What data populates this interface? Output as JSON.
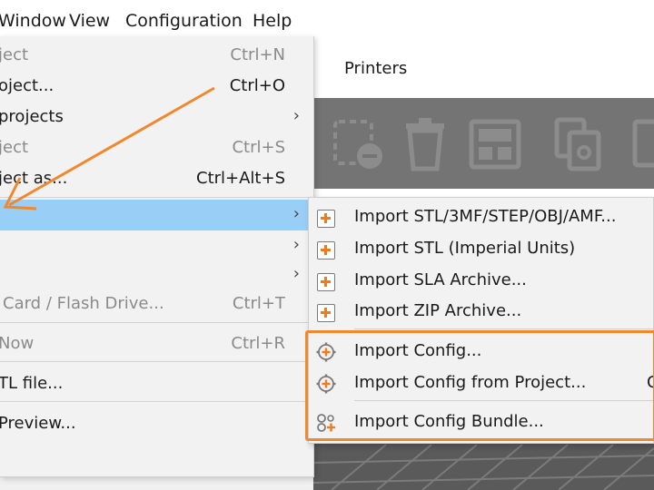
{
  "menubar": {
    "items": [
      "Window",
      "View",
      "Configuration",
      "Help"
    ]
  },
  "app": {
    "printers_tab": "Printers"
  },
  "file_menu": {
    "items": [
      {
        "label": "ject",
        "shortcut": "Ctrl+N",
        "disabled": true
      },
      {
        "label": "oject...",
        "shortcut": "Ctrl+O",
        "disabled": false
      },
      {
        "label": "projects",
        "shortcut": "",
        "submenu": true
      },
      {
        "label": "ject",
        "shortcut": "Ctrl+S",
        "disabled": true
      },
      {
        "label": "ject as...",
        "shortcut": "Ctrl+Alt+S",
        "disabled": false
      },
      {
        "label": "",
        "shortcut": "",
        "submenu": true,
        "highlighted": true
      },
      {
        "label": "",
        "shortcut": "",
        "submenu": true
      },
      {
        "label": "",
        "shortcut": "",
        "submenu": true
      },
      {
        "label": "Card / Flash Drive...",
        "shortcut": "Ctrl+T",
        "disabled": true
      },
      {
        "label": "Now",
        "shortcut": "Ctrl+R",
        "disabled": true
      },
      {
        "label": "TL file...",
        "shortcut": "",
        "disabled": false
      },
      {
        "label": "Preview...",
        "shortcut": "",
        "disabled": false
      }
    ]
  },
  "import_submenu": {
    "items": [
      {
        "label": "Import STL/3MF/STEP/OBJ/AMF...",
        "icon": "plus-icon"
      },
      {
        "label": "Import STL (Imperial Units)",
        "icon": "plus-icon"
      },
      {
        "label": "Import SLA Archive...",
        "icon": "plus-icon"
      },
      {
        "label": "Import ZIP Archive...",
        "icon": "plus-icon"
      },
      {
        "label": "Import Config...",
        "icon": "gear-plus-icon"
      },
      {
        "label": "Import Config from Project...",
        "shortcut_partial": "C",
        "icon": "gear-plus-icon"
      },
      {
        "label": "Import Config Bundle...",
        "icon": "config-bundle-icon"
      }
    ]
  },
  "colors": {
    "highlight_row": "#99cff6",
    "accent_orange": "#f0892e",
    "toolbar_gray": "#747474"
  }
}
